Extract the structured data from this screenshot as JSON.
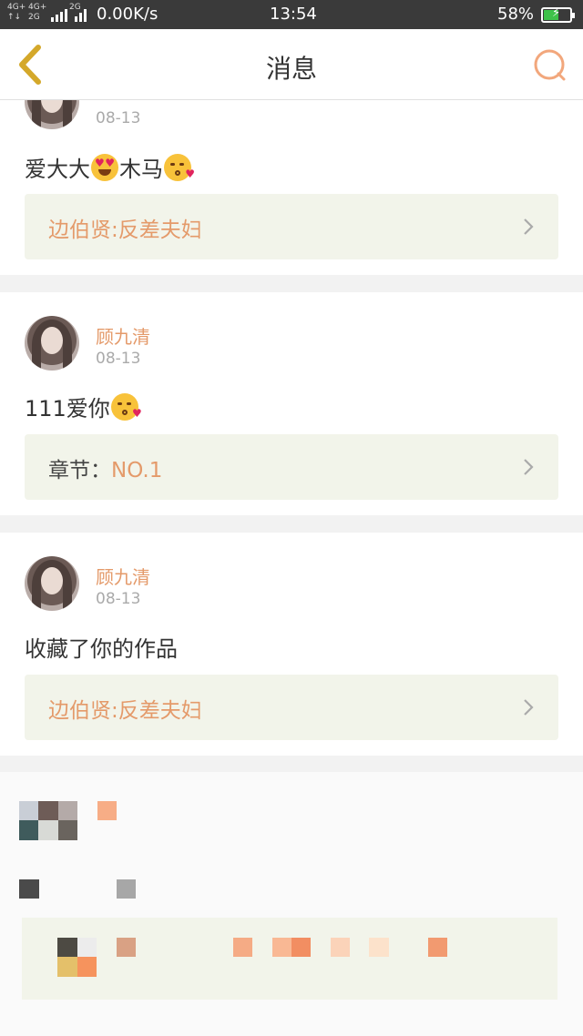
{
  "status_bar": {
    "net1_top": "4G+",
    "net1_bottom": "↑↓",
    "net2_top": "4G+",
    "net2_bottom": "2G",
    "net3": "2G",
    "speed": "0.00K/s",
    "time": "13:54",
    "battery": "58%"
  },
  "header": {
    "title": "消息",
    "back_icon": "chevron-left-icon",
    "search_icon": "search-icon"
  },
  "colors": {
    "accent": "#e49a6a",
    "back_icon": "#d4a82a",
    "link_bg": "#f2f4ea"
  },
  "messages": [
    {
      "user": "",
      "date": "08-13",
      "text_before": "爱大大",
      "emoji1": "heart-eyes-emoji",
      "text_mid": "木马",
      "emoji2": "kissing-heart-emoji",
      "link_text": "边伯贤:反差夫妇"
    },
    {
      "user": "顾九清",
      "date": "08-13",
      "text_before": "111爱你",
      "emoji1": "kissing-heart-emoji",
      "link_prefix": "章节：",
      "link_text": "NO.1"
    },
    {
      "user": "顾九清",
      "date": "08-13",
      "text": "收藏了你的作品",
      "link_text": "边伯贤:反差夫妇"
    }
  ]
}
